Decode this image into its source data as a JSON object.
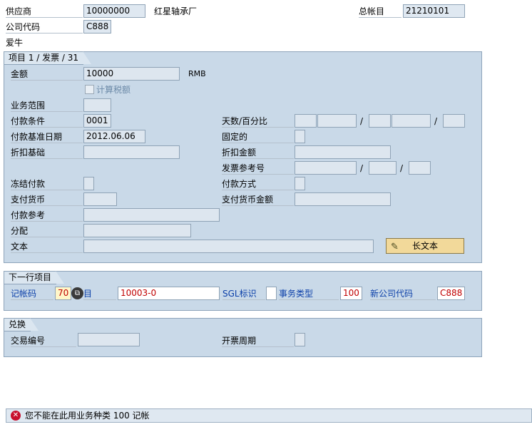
{
  "header": {
    "vendor_label": "供应商",
    "vendor_value": "10000000",
    "vendor_name": "红星轴承厂",
    "gl_label": "总帐目",
    "gl_value": "21210101",
    "company_label": "公司代码",
    "company_value": "C888",
    "company_name": "爱牛"
  },
  "item_group": {
    "title": "项目 1 / 发票 / 31",
    "amount_label": "金额",
    "amount_value": "10000",
    "currency": "RMB",
    "calc_tax_label": "计算税额",
    "business_area_label": "业务范围",
    "payment_terms_label": "付款条件",
    "payment_terms_value": "0001",
    "days_pct_label": "天数/百分比",
    "baseline_date_label": "付款基准日期",
    "baseline_date_value": "2012.06.06",
    "fixed_label": "固定的",
    "discount_base_label": "折扣基础",
    "discount_amount_label": "折扣金额",
    "invoice_ref_label": "发票参考号",
    "payment_block_label": "冻结付款",
    "payment_method_label": "付款方式",
    "pay_currency_label": "支付货币",
    "pay_currency_amount_label": "支付货币金额",
    "payment_ref_label": "付款参考",
    "assignment_label": "分配",
    "text_label": "文本",
    "long_text_button": "长文本",
    "slash": "/"
  },
  "next_item": {
    "title": "下一行项目",
    "posting_key_label": "记帐码",
    "posting_key_value": "70",
    "account_label": "目",
    "account_value": "10003-0",
    "sgl_label": "SGL标识",
    "trans_type_label": "事务类型",
    "trans_type_value": "100",
    "new_company_label": "新公司代码",
    "new_company_value": "C888"
  },
  "exchange": {
    "title": "兑换",
    "trade_id_label": "交易编号",
    "billing_period_label": "开票周期"
  },
  "status": {
    "message": "您不能在此用业务种类 100 记帐"
  }
}
